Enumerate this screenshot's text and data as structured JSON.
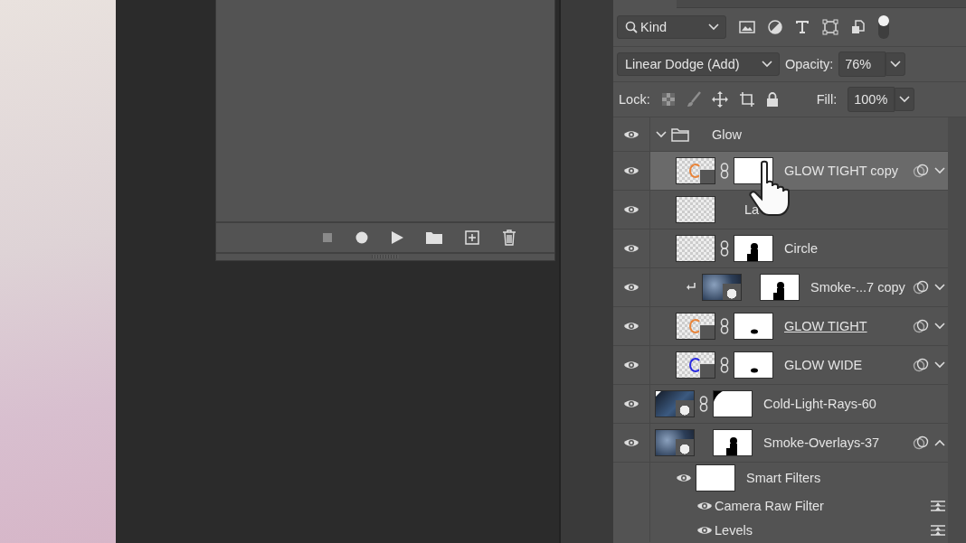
{
  "layers_panel": {
    "filter": {
      "label": "Kind",
      "toggle_on": true
    },
    "blend_mode": "Linear Dodge (Add)",
    "opacity": {
      "label": "Opacity:",
      "value": "76%"
    },
    "lock": {
      "label": "Lock:"
    },
    "fill": {
      "label": "Fill:",
      "value": "100%"
    },
    "layers": [
      {
        "kind": "group",
        "name": "Glow",
        "visible": true,
        "selected": false,
        "expanded": true,
        "children": [
          {
            "kind": "layer",
            "name": "GLOW TIGHT copy",
            "visible": true,
            "selected": true,
            "thumb": {
              "kind": "smart_orange"
            },
            "linked": true,
            "mask": {
              "kind": "white"
            },
            "options": true,
            "expanded": false
          },
          {
            "kind": "layer",
            "name": "La",
            "visible": true,
            "selected": false,
            "thumb": {
              "kind": "transparent"
            }
          },
          {
            "kind": "layer",
            "name": "Circle",
            "visible": true,
            "selected": false,
            "thumb": {
              "kind": "transparent"
            },
            "linked": true,
            "mask": {
              "kind": "figure"
            }
          },
          {
            "kind": "layer",
            "name": "Smoke-...7 copy",
            "visible": true,
            "selected": false,
            "thumb": {
              "kind": "smoke"
            },
            "mask": {
              "kind": "figure"
            },
            "clipped": true,
            "options": true,
            "expanded": false
          },
          {
            "kind": "layer",
            "name": "GLOW TIGHT",
            "visible": true,
            "selected": false,
            "thumb": {
              "kind": "smart_orange"
            },
            "linked": true,
            "mask": {
              "kind": "dot"
            },
            "underlined": true,
            "options": true,
            "expanded": false
          },
          {
            "kind": "layer",
            "name": "GLOW WIDE",
            "visible": true,
            "selected": false,
            "thumb": {
              "kind": "smart_blue"
            },
            "linked": true,
            "mask": {
              "kind": "dot"
            },
            "options": true,
            "expanded": false
          }
        ]
      },
      {
        "kind": "layer",
        "name": "Cold-Light-Rays-60",
        "visible": true,
        "selected": false,
        "thumb": {
          "kind": "rays"
        },
        "linked": true,
        "mask": {
          "kind": "corner"
        }
      },
      {
        "kind": "layer",
        "name": "Smoke-Overlays-37",
        "visible": true,
        "selected": false,
        "thumb": {
          "kind": "smoke"
        },
        "mask": {
          "kind": "figure"
        },
        "options": true,
        "expanded": true,
        "children": [
          {
            "kind": "smart_filters",
            "name": "Smart Filters",
            "visible": true,
            "selected": false,
            "children": [
              {
                "kind": "filter",
                "name": "Camera Raw Filter",
                "visible": true,
                "selected": false
              },
              {
                "kind": "filter",
                "name": "Levels",
                "visible": true,
                "selected": false
              }
            ]
          }
        ]
      }
    ]
  }
}
